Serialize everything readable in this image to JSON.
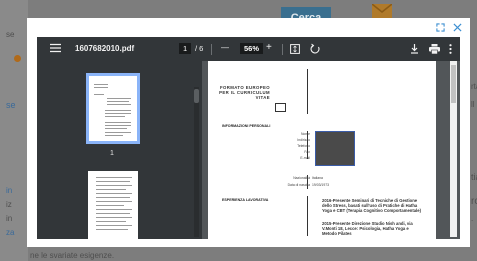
{
  "background": {
    "button_label": "Cerca",
    "fragments": [
      "se",
      "se",
      "in",
      "iz",
      "in",
      "za",
      "ne le svariate esigenze.",
      "rta",
      "ll",
      "tia",
      "rc",
      "."
    ]
  },
  "modal": {
    "expand_icon": "expand-icon",
    "close_icon": "close-icon"
  },
  "toolbar": {
    "filename": "1607682010.pdf",
    "page_current": "1",
    "page_total": "/ 6",
    "zoom_out": "—",
    "zoom_value": "56%",
    "zoom_in": "+",
    "fit_icon": "fit-page-icon",
    "rotate_icon": "rotate-icon",
    "download_icon": "download-icon",
    "print_icon": "print-icon",
    "more_icon": "more-vert-icon"
  },
  "sidebar": {
    "thumb_1_label": "1"
  },
  "document": {
    "header_line1": "FORMATO EUROPEO",
    "header_line2": "PER IL CURRICULUM",
    "header_line3": "VITAE",
    "section_personal": "INFORMAZIONI PERSONALI",
    "labels": [
      "Nome",
      "Indirizzo",
      "Telefono",
      "Fax",
      "E-mail"
    ],
    "label_nationality": "Nazionalità",
    "value_nationality": "Italiana",
    "label_birth": "Data di nascita",
    "value_birth": "19/03/1973",
    "section_experience": "ESPERIENZA LAVORATIVA",
    "exp_1": "2016-Presente Seminari di Tecniche di Gestione dello Stress, basati sull'uso di Pratiche di Hatha Yoga e CBT (Terapia Cognitivo Comportamentale)",
    "exp_2": "2015-Presente Direzione Studio Nish andi, via V.Monti 18, Lecce: Psicologia, Hatha Yoga e Metodo Pilates"
  },
  "colors": {
    "accent": "#3d8fd1",
    "toolbar_bg": "#323639",
    "viewer_bg": "#525659",
    "button_bg": "#3a6f8f"
  }
}
